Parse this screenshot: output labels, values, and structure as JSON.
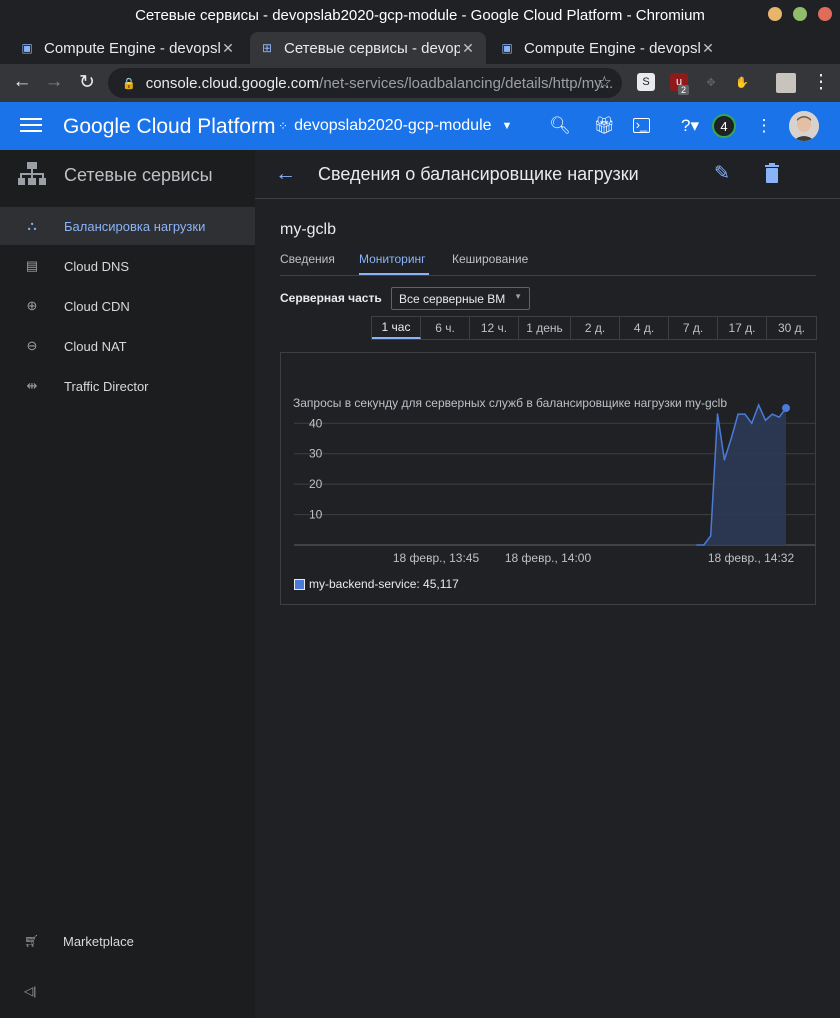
{
  "window": {
    "title": "Сетевые сервисы - devopslab2020-gcp-module - Google Cloud Platform - Chromium"
  },
  "browser": {
    "tabs": [
      {
        "title": "Compute Engine - devopsla",
        "active": false
      },
      {
        "title": "Сетевые сервисы - devops",
        "active": true
      },
      {
        "title": "Compute Engine - devopsla",
        "active": false
      }
    ],
    "url_host": "console.cloud.google.com",
    "url_path": "/net-services/loadbalancing/details/http/my...",
    "ext_badge": "2"
  },
  "header": {
    "logo": "Google Cloud Platform",
    "project": "devopslab2020-gcp-module",
    "notifications": "4"
  },
  "sidebar": {
    "title": "Сетевые сервисы",
    "items": [
      {
        "label": "Балансировка нагрузки",
        "icon": "load-balancing-icon",
        "active": true
      },
      {
        "label": "Cloud DNS",
        "icon": "dns-icon",
        "active": false
      },
      {
        "label": "Cloud CDN",
        "icon": "cdn-icon",
        "active": false
      },
      {
        "label": "Cloud NAT",
        "icon": "nat-icon",
        "active": false
      },
      {
        "label": "Traffic Director",
        "icon": "traffic-director-icon",
        "active": false
      }
    ],
    "marketplace": "Marketplace"
  },
  "page": {
    "title": "Сведения о балансировщике нагрузки",
    "lb_name": "my-gclb",
    "tabs": [
      "Сведения",
      "Мониторинг",
      "Кеширование"
    ],
    "active_tab": "Мониторинг",
    "backend_label": "Серверная часть",
    "backend_value": "Все серверные ВМ",
    "time_ranges": [
      "1 час",
      "6 ч.",
      "12 ч.",
      "1 день",
      "2 д.",
      "4 д.",
      "7 д.",
      "17 д.",
      "30 д."
    ],
    "active_range": "1 час"
  },
  "chart_data": {
    "type": "area",
    "title": "Запросы в секунду для серверных служб в балансировщике нагрузки my-gclb",
    "xlabel": "",
    "ylabel": "",
    "x_tick_labels": [
      "18 февр., 13:45",
      "18 февр., 14:00",
      "18 февр., 14:32"
    ],
    "y_ticks": [
      10,
      20,
      30,
      40
    ],
    "ylim": [
      0,
      46
    ],
    "grid": true,
    "series": [
      {
        "name": "my-backend-service: 45,117",
        "color": "#4a7bd8",
        "x_minutes": [
          0,
          1,
          2,
          3,
          4,
          5,
          6,
          7,
          8,
          9,
          10,
          11,
          12,
          13
        ],
        "values": [
          0,
          0,
          3,
          43,
          28,
          35,
          43,
          43,
          40,
          46,
          41,
          43,
          42,
          45
        ]
      }
    ]
  }
}
